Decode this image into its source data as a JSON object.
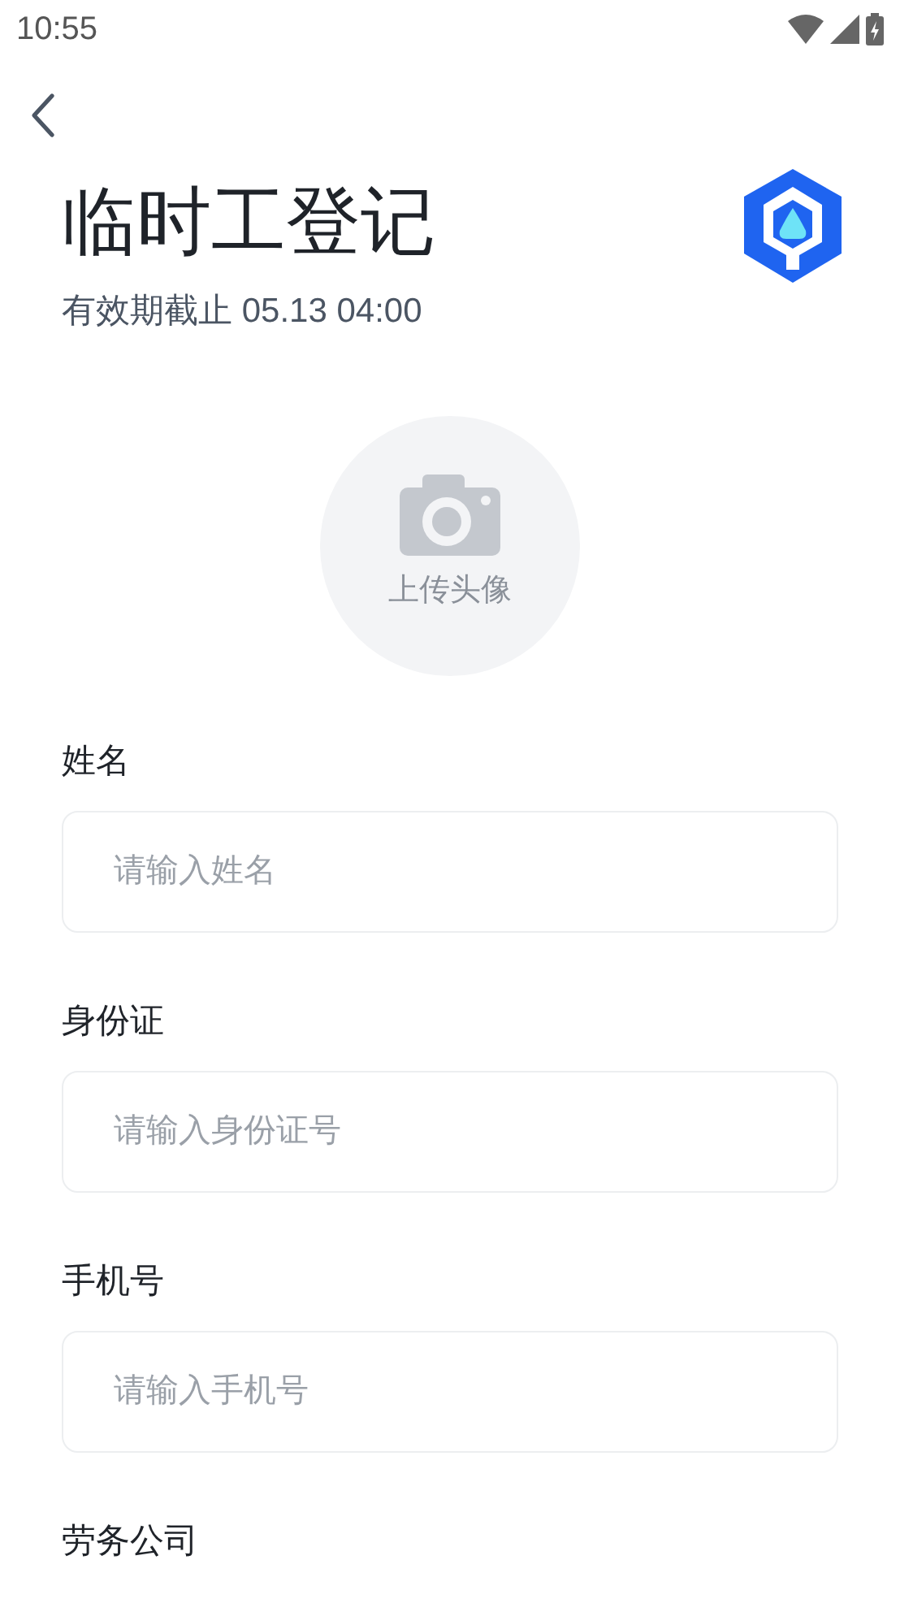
{
  "status_bar": {
    "time": "10:55"
  },
  "header": {
    "title": "临时工登记",
    "subtitle": "有效期截止 05.13 04:00"
  },
  "avatar_upload": {
    "label": "上传头像"
  },
  "fields": [
    {
      "label": "姓名",
      "placeholder": "请输入姓名"
    },
    {
      "label": "身份证",
      "placeholder": "请输入身份证号"
    },
    {
      "label": "手机号",
      "placeholder": "请输入手机号"
    },
    {
      "label": "劳务公司"
    }
  ]
}
